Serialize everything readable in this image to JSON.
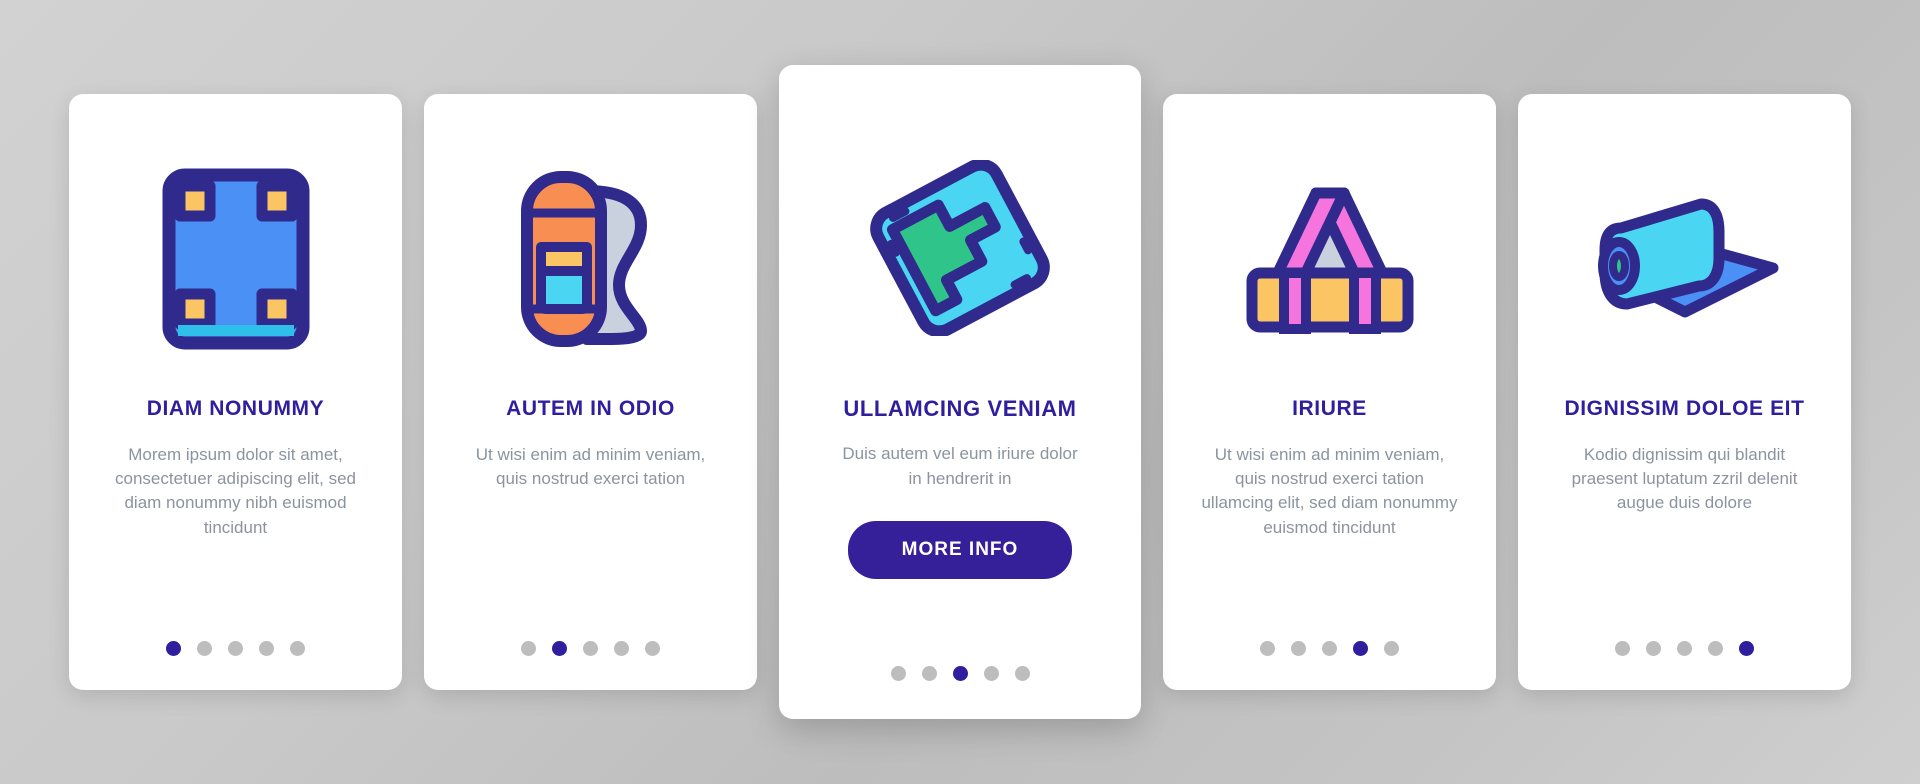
{
  "theme": {
    "background_gradient_from": "#d2d2d2",
    "background_gradient_to": "#cfcfcf",
    "card_background": "#ffffff",
    "title_color": "#2f1f9e",
    "body_color": "#8b949e",
    "accent_color": "#35209a",
    "dot_inactive_color": "#bdbdbd",
    "dot_active_color": "#2f1f9e",
    "icon_outline_color": "#2f2a8c"
  },
  "cards": [
    {
      "icon_name": "camping-mat-icon",
      "title": "DIAM NONUMMY",
      "body": "Morem ipsum dolor sit amet, consectetuer adipiscing elit, sed diam nonummy nibh euismod tincidunt",
      "dots": {
        "count": 5,
        "active_index": 0
      },
      "featured": false,
      "icon_colors": {
        "fill": "#4a90f5",
        "corner": "#fbc564",
        "strip": "#2fc0ea",
        "outline": "#2f2a8c"
      }
    },
    {
      "icon_name": "rolled-sleeping-pad-icon",
      "title": "AUTEM IN ODIO",
      "body": "Ut wisi enim ad minim veniam, quis nostrud exerci tation",
      "dots": {
        "count": 5,
        "active_index": 1
      },
      "featured": false,
      "icon_colors": {
        "fill": "#f98e52",
        "band_top": "#fbc564",
        "band_bottom": "#4ad6f2",
        "side": "#c8d1dd",
        "outline": "#2f2a8c"
      }
    },
    {
      "icon_name": "tilted-mat-icon",
      "title": "ULLAMCING VENIAM",
      "body": "Duis autem vel eum iriure dolor in hendrerit in",
      "button_label": "MORE INFO",
      "dots": {
        "count": 5,
        "active_index": 2
      },
      "featured": true,
      "icon_colors": {
        "frame": "#4ad6f2",
        "inner": "#2fc58a",
        "outline": "#2f2a8c"
      }
    },
    {
      "icon_name": "mat-with-strap-icon",
      "title": "IRIURE",
      "body": "Ut wisi enim ad minim veniam, quis nostrud exerci tation ullamcing elit, sed diam nonummy euismod tincidunt",
      "dots": {
        "count": 5,
        "active_index": 3
      },
      "featured": false,
      "icon_colors": {
        "roll": "#fbc564",
        "strap": "#f574dd",
        "handle_fill": "#c8d1dd",
        "outline": "#2f2a8c"
      }
    },
    {
      "icon_name": "unrolled-yoga-mat-icon",
      "title": "DIGNISSIM DOLOE EIT",
      "body": "Kodio dignissim qui blandit praesent luptatum zzril delenit augue duis dolore",
      "dots": {
        "count": 5,
        "active_index": 4
      },
      "featured": false,
      "icon_colors": {
        "roll": "#4ad6f2",
        "sheet": "#4a90f5",
        "core": "#2fc0ea",
        "outline": "#2f2a8c"
      }
    }
  ]
}
